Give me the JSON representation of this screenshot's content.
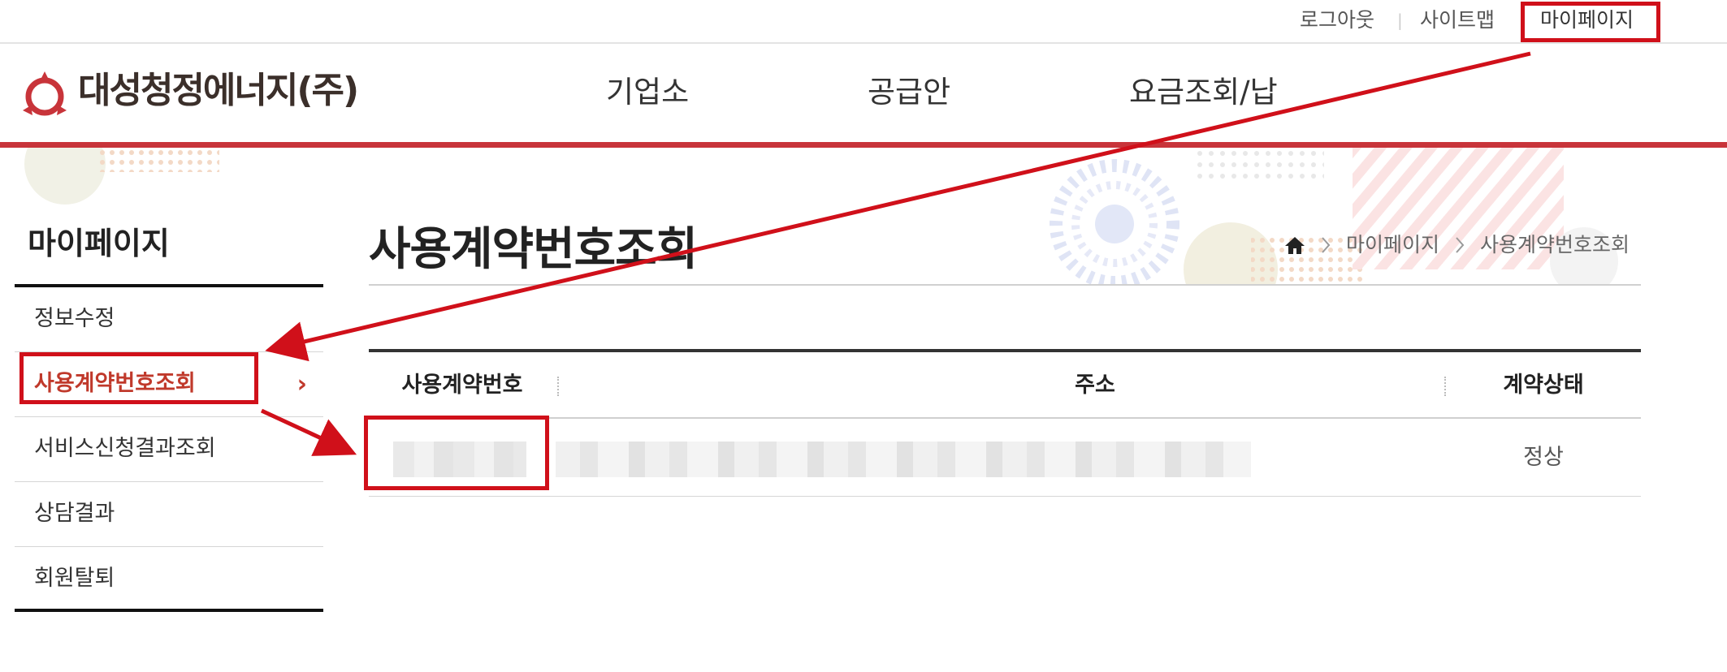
{
  "util_nav": {
    "logout": "로그아웃",
    "separator": "|",
    "sitemap": "사이트맵",
    "mypage": "마이페이지"
  },
  "header": {
    "logo_text": "대성청정에너지(주)",
    "gnb": [
      "기업소",
      "공급안",
      "요금조회/납"
    ]
  },
  "sidebar": {
    "title": "마이페이지",
    "items": [
      {
        "label": "정보수정"
      },
      {
        "label": "사용계약번호조회",
        "active": true
      },
      {
        "label": "서비스신청결과조회"
      },
      {
        "label": "상담결과"
      },
      {
        "label": "회원탈퇴"
      }
    ],
    "active_arrow": "›"
  },
  "main": {
    "page_title": "사용계약번호조회",
    "breadcrumb": [
      "마이페이지",
      "사용계약번호조회"
    ],
    "table": {
      "headers": [
        "사용계약번호",
        "주소",
        "계약상태"
      ],
      "rows": [
        {
          "contract_no": "",
          "address": "",
          "status": "정상"
        }
      ]
    }
  },
  "icons": {
    "home": "home-icon",
    "breadcrumb_sep": "chevron-right-icon",
    "logo": "flame-logo-icon"
  },
  "colors": {
    "brand_red": "#c8343a",
    "active_red": "#c0392b",
    "annotation_red": "#d0101a"
  }
}
